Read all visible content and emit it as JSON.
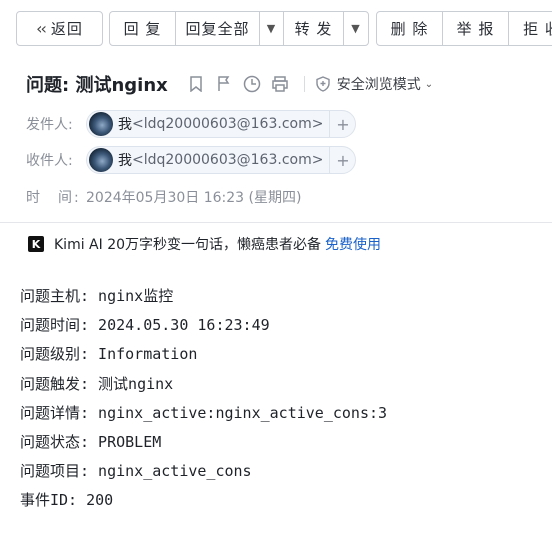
{
  "toolbar": {
    "back": "返回",
    "reply": "回 复",
    "reply_all": "回复全部",
    "forward": "转 发",
    "delete": "删 除",
    "report": "举 报",
    "reject": "拒 收"
  },
  "header": {
    "subject": "问题: 测试nginx",
    "safe_mode": "安全浏览模式",
    "from_label": "发件人:",
    "to_label": "收件人:",
    "sender": {
      "name": "我",
      "email": "<ldq20000603@163.com>"
    },
    "recipient": {
      "name": "我",
      "email": "<ldq20000603@163.com>"
    },
    "time_label": "时　间:",
    "time_value": "2024年05月30日 16:23 (星期四)"
  },
  "ad": {
    "logo": "K",
    "text": "Kimi AI 20万字秒变一句话，懒癌患者必备",
    "link": "免费使用"
  },
  "body": {
    "lines": [
      "问题主机: nginx监控",
      "问题时间: 2024.05.30 16:23:49",
      "问题级别: Information",
      "问题触发: 测试nginx",
      "问题详情: nginx_active:nginx_active_cons:3",
      "问题状态: PROBLEM",
      "问题项目: nginx_active_cons",
      "事件ID: 200"
    ]
  }
}
